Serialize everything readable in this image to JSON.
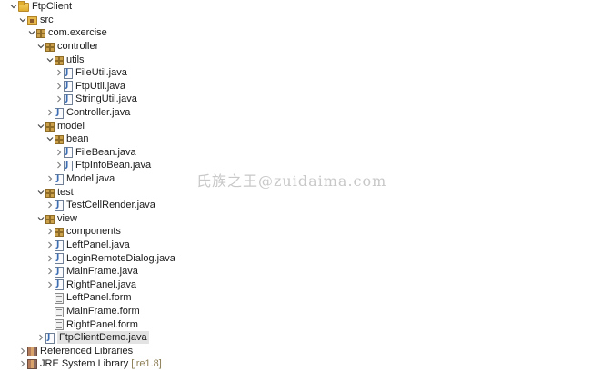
{
  "tree": [
    {
      "label": "FtpClient",
      "level": 0,
      "expanded": true,
      "icon": "project-icon"
    },
    {
      "label": "src",
      "level": 1,
      "expanded": true,
      "icon": "source-folder-icon"
    },
    {
      "label": "com.exercise",
      "level": 2,
      "expanded": true,
      "icon": "package-icon"
    },
    {
      "label": "controller",
      "level": 3,
      "expanded": true,
      "icon": "package-icon"
    },
    {
      "label": "utils",
      "level": 4,
      "expanded": true,
      "icon": "package-icon"
    },
    {
      "label": "FileUtil.java",
      "level": 5,
      "expanded": false,
      "icon": "java-file-icon"
    },
    {
      "label": "FtpUtil.java",
      "level": 5,
      "expanded": false,
      "icon": "java-file-icon"
    },
    {
      "label": "StringUtil.java",
      "level": 5,
      "expanded": false,
      "icon": "java-file-icon"
    },
    {
      "label": "Controller.java",
      "level": 4,
      "expanded": false,
      "icon": "java-file-icon"
    },
    {
      "label": "model",
      "level": 3,
      "expanded": true,
      "icon": "package-icon"
    },
    {
      "label": "bean",
      "level": 4,
      "expanded": true,
      "icon": "package-icon"
    },
    {
      "label": "FileBean.java",
      "level": 5,
      "expanded": false,
      "icon": "java-file-icon"
    },
    {
      "label": "FtpInfoBean.java",
      "level": 5,
      "expanded": false,
      "icon": "java-file-icon"
    },
    {
      "label": "Model.java",
      "level": 4,
      "expanded": false,
      "icon": "java-file-icon"
    },
    {
      "label": "test",
      "level": 3,
      "expanded": true,
      "icon": "package-icon"
    },
    {
      "label": "TestCellRender.java",
      "level": 4,
      "expanded": false,
      "icon": "java-file-icon"
    },
    {
      "label": "view",
      "level": 3,
      "expanded": true,
      "icon": "package-icon"
    },
    {
      "label": "components",
      "level": 4,
      "expanded": false,
      "icon": "package-icon"
    },
    {
      "label": "LeftPanel.java",
      "level": 4,
      "expanded": false,
      "icon": "java-file-icon"
    },
    {
      "label": "LoginRemoteDialog.java",
      "level": 4,
      "expanded": false,
      "icon": "java-file-icon"
    },
    {
      "label": "MainFrame.java",
      "level": 4,
      "expanded": false,
      "icon": "java-file-icon"
    },
    {
      "label": "RightPanel.java",
      "level": 4,
      "expanded": false,
      "icon": "java-file-icon"
    },
    {
      "label": "LeftPanel.form",
      "level": 4,
      "expanded": null,
      "icon": "form-file-icon"
    },
    {
      "label": "MainFrame.form",
      "level": 4,
      "expanded": null,
      "icon": "form-file-icon"
    },
    {
      "label": "RightPanel.form",
      "level": 4,
      "expanded": null,
      "icon": "form-file-icon"
    },
    {
      "label": "FtpClientDemo.java",
      "level": 3,
      "expanded": false,
      "icon": "java-file-icon",
      "selected": true
    },
    {
      "label": "Referenced Libraries",
      "level": 1,
      "expanded": false,
      "icon": "library-icon"
    },
    {
      "label": "JRE System Library",
      "level": 1,
      "expanded": false,
      "icon": "library-icon",
      "suffix": "[jre1.8]"
    }
  ],
  "watermark": "氏族之王@zuidaima.com",
  "colors": {
    "selection": "#e3e3e3",
    "suffix": "#8a7c52",
    "watermark": "#c8c8c8"
  }
}
